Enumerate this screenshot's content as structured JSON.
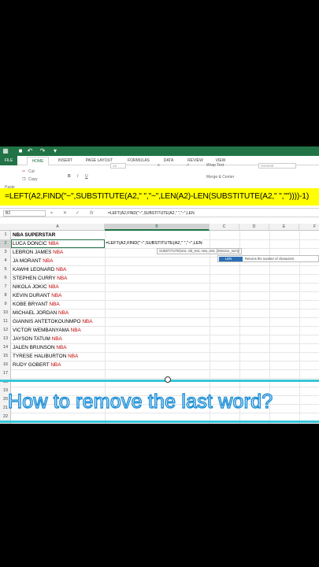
{
  "quick_access": {
    "icons": [
      "excel-logo-icon",
      "save-icon",
      "undo-icon",
      "redo-icon",
      "customize-icon"
    ],
    "glyphs": [
      "▦",
      "■",
      "↶",
      "↷",
      "▾"
    ]
  },
  "tabs": [
    {
      "label": "FILE"
    },
    {
      "label": "HOME"
    },
    {
      "label": "INSERT"
    },
    {
      "label": "PAGE LAYOUT"
    },
    {
      "label": "FORMULAS"
    },
    {
      "label": "DATA"
    },
    {
      "label": "REVIEW"
    },
    {
      "label": "VIEW"
    }
  ],
  "ribbon": {
    "cut": "Cut",
    "copy": "Copy",
    "paste": "Paste",
    "font_size": "12",
    "wrap_text": "Wrap Text",
    "merge_center": "Merge & Center",
    "number_format": "General"
  },
  "banner": {
    "formula": "=LEFT(A2,FIND(\"~\",SUBSTITUTE(A2,\" \",\"~\",LEN(A2)-LEN(SUBSTITUTE(A2,\" \",\"\"))))-1)",
    "color": "#ffff00"
  },
  "formula_bar": {
    "name_box": "B2",
    "cancel": "✕",
    "enter": "✓",
    "fx": "fx",
    "formula": "=LEFT(A2,FIND(\"~\",SUBSTITUTE(A2,\" \",\"~\",LEN"
  },
  "sheet": {
    "columns": [
      "A",
      "B",
      "C",
      "D",
      "E",
      "F"
    ],
    "rows": [
      "1",
      "2",
      "3",
      "4",
      "5",
      "6",
      "7",
      "8",
      "9",
      "10",
      "11",
      "12",
      "13",
      "14",
      "15",
      "16",
      "17",
      "18",
      "19",
      "20",
      "21",
      "22"
    ],
    "header": "NBA SUPERSTAR",
    "players": [
      {
        "name": "LUCA DONCIC",
        "tag": "NBA"
      },
      {
        "name": "LEBRON JAMES",
        "tag": "NBA"
      },
      {
        "name": "JA MORANT",
        "tag": "NBA"
      },
      {
        "name": "KAWHI LEONARD",
        "tag": "NBA"
      },
      {
        "name": "STEPHEN CURRY",
        "tag": "NBA"
      },
      {
        "name": "NIKOLA JOKIC",
        "tag": "NBA"
      },
      {
        "name": "KEVIN DURANT",
        "tag": "NBA"
      },
      {
        "name": "KOBE BRYANT",
        "tag": "NBA"
      },
      {
        "name": "MICHAEL JORDAN",
        "tag": "NBA"
      },
      {
        "name": "GIANNIS ANTETOKOUNMPO",
        "tag": "NBA"
      },
      {
        "name": "VICTOR WEMBANYAMA",
        "tag": "NBA"
      },
      {
        "name": "JAYSON TATUM",
        "tag": "NBA"
      },
      {
        "name": "JALEN BRUNSON",
        "tag": "NBA"
      },
      {
        "name": "TYRESE HALIBURTON",
        "tag": "NBA"
      },
      {
        "name": "RUDY GOBERT",
        "tag": "NBA"
      }
    ],
    "editing_cell": "=LEFT(A2,FIND(\"~\",SUBSTITUTE(A2,\" \",\"~\",LEN",
    "tooltip": "SUBSTITUTE(text, old_text, new_text, [instance_num])",
    "autocomplete_item": "LEN",
    "autocomplete_desc": "Returns the number of characters"
  },
  "caption": {
    "text": "How to remove the last word?"
  }
}
